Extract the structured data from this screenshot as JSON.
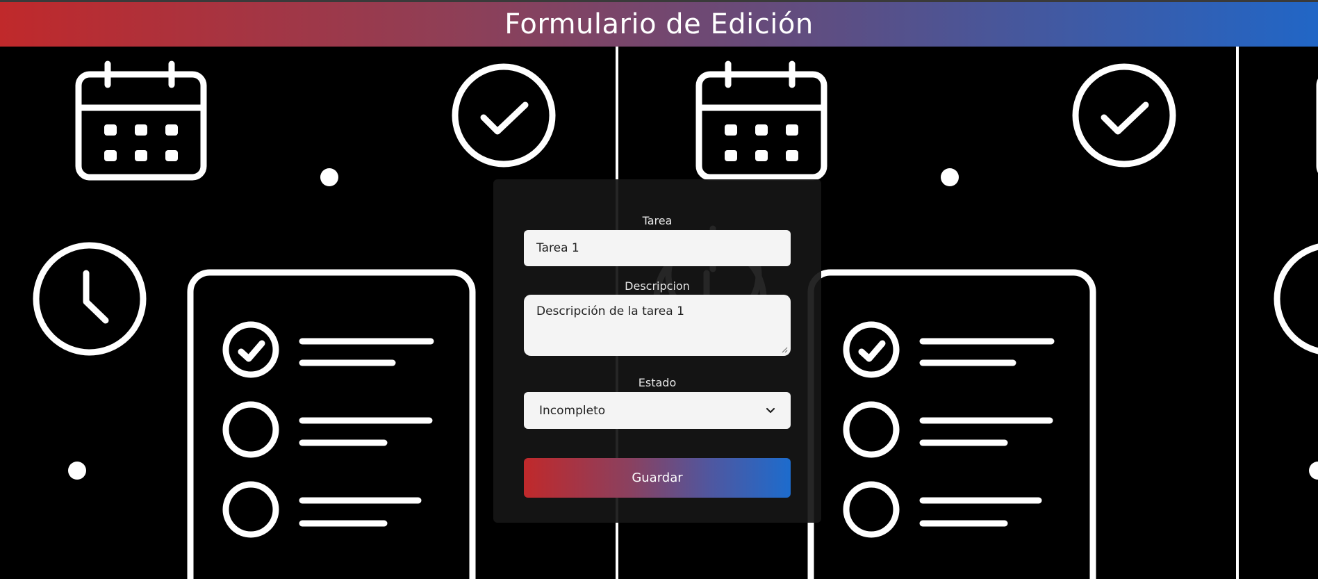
{
  "header": {
    "title": "Formulario de Edición"
  },
  "background": {
    "icons": [
      "calendar-icon",
      "check-circle-icon",
      "clock-icon",
      "checklist-icon",
      "power-icon"
    ]
  },
  "colors": {
    "accent_start": "#c0292b",
    "accent_end": "#1d6ccd",
    "panel": "#161616",
    "input_bg": "#f4f4f4"
  },
  "form": {
    "task_label": "Tarea",
    "task_value": "Tarea 1",
    "description_label": "Descripcion",
    "description_value": "Descripción de la tarea 1",
    "status_label": "Estado",
    "status_value": "Incompleto",
    "save_label": "Guardar"
  }
}
